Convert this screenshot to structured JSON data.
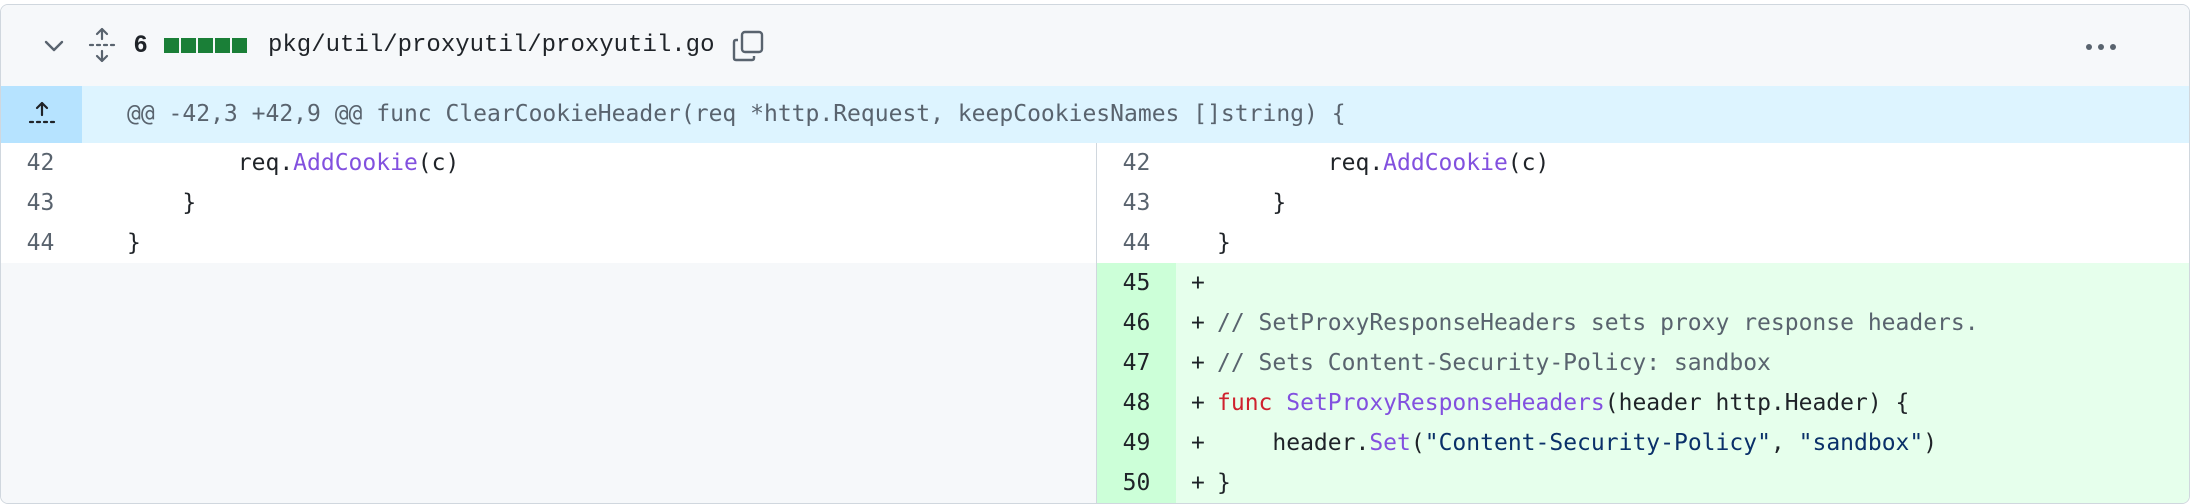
{
  "file": {
    "changes": "6",
    "diffstat_blocks": 5,
    "path": "pkg/util/proxyutil/proxyutil.go"
  },
  "hunk": {
    "header": "@@ -42,3 +42,9 @@ func ClearCookieHeader(req *http.Request, keepCookiesNames []string) {"
  },
  "context_lines": [
    {
      "old": "42",
      "new": "42",
      "indent": "        ",
      "obj": "req.",
      "fn": "AddCookie",
      "rest": "(c)"
    },
    {
      "old": "43",
      "new": "43",
      "text": "    }"
    },
    {
      "old": "44",
      "new": "44",
      "text": "}"
    }
  ],
  "added_lines": [
    {
      "num": "45",
      "marker": "+",
      "text": ""
    },
    {
      "num": "46",
      "marker": "+",
      "comment": "// SetProxyResponseHeaders sets proxy response headers."
    },
    {
      "num": "47",
      "marker": "+",
      "comment": "// Sets Content-Security-Policy: sandbox"
    },
    {
      "num": "48",
      "marker": "+",
      "kw": "func",
      "fn": "SetProxyResponseHeaders",
      "rest": "(header http.Header) {"
    },
    {
      "num": "49",
      "marker": "+",
      "indent": "    ",
      "obj": "header.",
      "fn": "Set",
      "p1": "(",
      "s1": "\"Content-Security-Policy\"",
      "sep": ", ",
      "s2": "\"sandbox\"",
      "p2": ")"
    },
    {
      "num": "50",
      "marker": "+",
      "text": "}"
    }
  ],
  "colors": {
    "add_bg": "#e6ffec",
    "add_num_bg": "#ccffd8",
    "hunk_bg": "#ddf4ff",
    "diffstat": "#1a7f37",
    "function": "#8250df",
    "keyword": "#cf222e",
    "string": "#0a3069"
  },
  "icons": [
    "chevron-down-icon",
    "expand-all-icon",
    "copy-icon",
    "kebab-horizontal-icon",
    "expand-up-icon"
  ]
}
